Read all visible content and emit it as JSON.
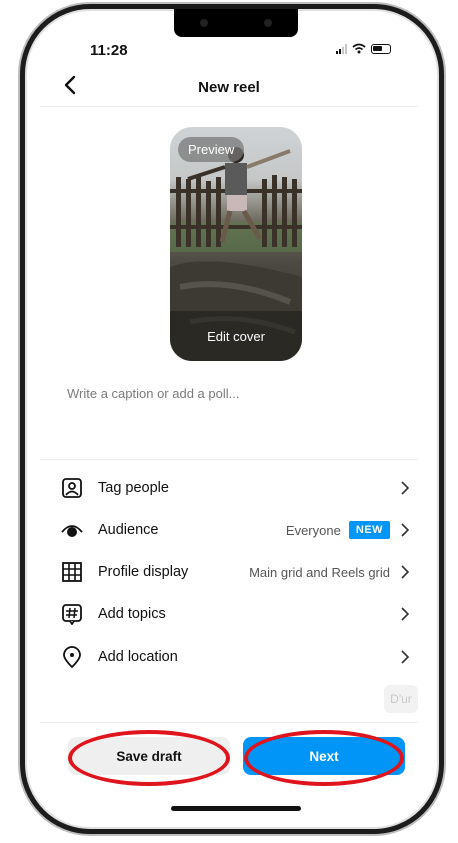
{
  "status_bar": {
    "time": "11:28",
    "signal_icon": "signal-icon",
    "wifi_icon": "wifi-icon",
    "battery_icon": "battery-icon"
  },
  "header": {
    "title": "New reel",
    "back_icon": "chevron-left-icon"
  },
  "reel": {
    "preview_label": "Preview",
    "edit_cover_label": "Edit cover"
  },
  "caption": {
    "placeholder": "Write a caption or add a poll..."
  },
  "options": [
    {
      "label": "Tag people",
      "icon": "tag-person-icon",
      "value": ""
    },
    {
      "label": "Audience",
      "icon": "eye-icon",
      "value": "Everyone",
      "badge": "NEW"
    },
    {
      "label": "Profile display",
      "icon": "grid-icon",
      "value": "Main grid and Reels grid"
    },
    {
      "label": "Add topics",
      "icon": "hashtag-icon",
      "value": ""
    },
    {
      "label": "Add location",
      "icon": "location-pin-icon",
      "value": ""
    }
  ],
  "suggestion_chip": "D'ur",
  "actions": {
    "save_draft_label": "Save draft",
    "next_label": "Next"
  },
  "colors": {
    "accent": "#0095f6",
    "highlight": "#e0141c"
  }
}
